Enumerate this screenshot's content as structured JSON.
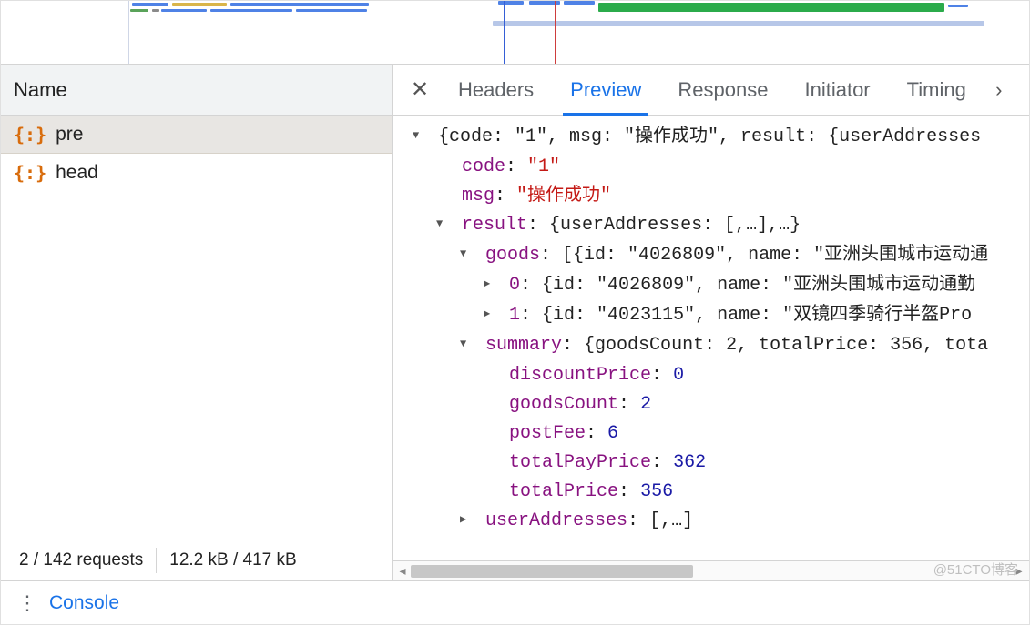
{
  "left": {
    "header": "Name",
    "requests": [
      {
        "name": "pre",
        "selected": true
      },
      {
        "name": "head",
        "selected": false
      }
    ],
    "status": {
      "requests": "2 / 142 requests",
      "transfer": "12.2 kB / 417 kB"
    }
  },
  "tabs": {
    "headers": "Headers",
    "preview": "Preview",
    "response": "Response",
    "initiator": "Initiator",
    "timing": "Timing"
  },
  "preview": {
    "root_summary": "{code: \"1\", msg: \"操作成功\", result: {userAddresses",
    "code_key": "code",
    "code_val": "\"1\"",
    "msg_key": "msg",
    "msg_val": "\"操作成功\"",
    "result_key": "result",
    "result_summary": "{userAddresses: [,…],…}",
    "goods_key": "goods",
    "goods_summary": "[{id: \"4026809\", name: \"亚洲头围城市运动通",
    "goods_0_key": "0",
    "goods_0_summary": "{id: \"4026809\", name: \"亚洲头围城市运动通勤",
    "goods_1_key": "1",
    "goods_1_summary": "{id: \"4023115\", name: \"双镜四季骑行半盔Pro ",
    "summary_key": "summary",
    "summary_short": "{goodsCount: 2, totalPrice: 356, tota",
    "discountPrice_key": "discountPrice",
    "discountPrice_val": "0",
    "goodsCount_key": "goodsCount",
    "goodsCount_val": "2",
    "postFee_key": "postFee",
    "postFee_val": "6",
    "totalPayPrice_key": "totalPayPrice",
    "totalPayPrice_val": "362",
    "totalPrice_key": "totalPrice",
    "totalPrice_val": "356",
    "userAddresses_key": "userAddresses",
    "userAddresses_summary": "[,…]"
  },
  "drawer": {
    "label": "Console"
  },
  "watermark": "@51CTO博客"
}
